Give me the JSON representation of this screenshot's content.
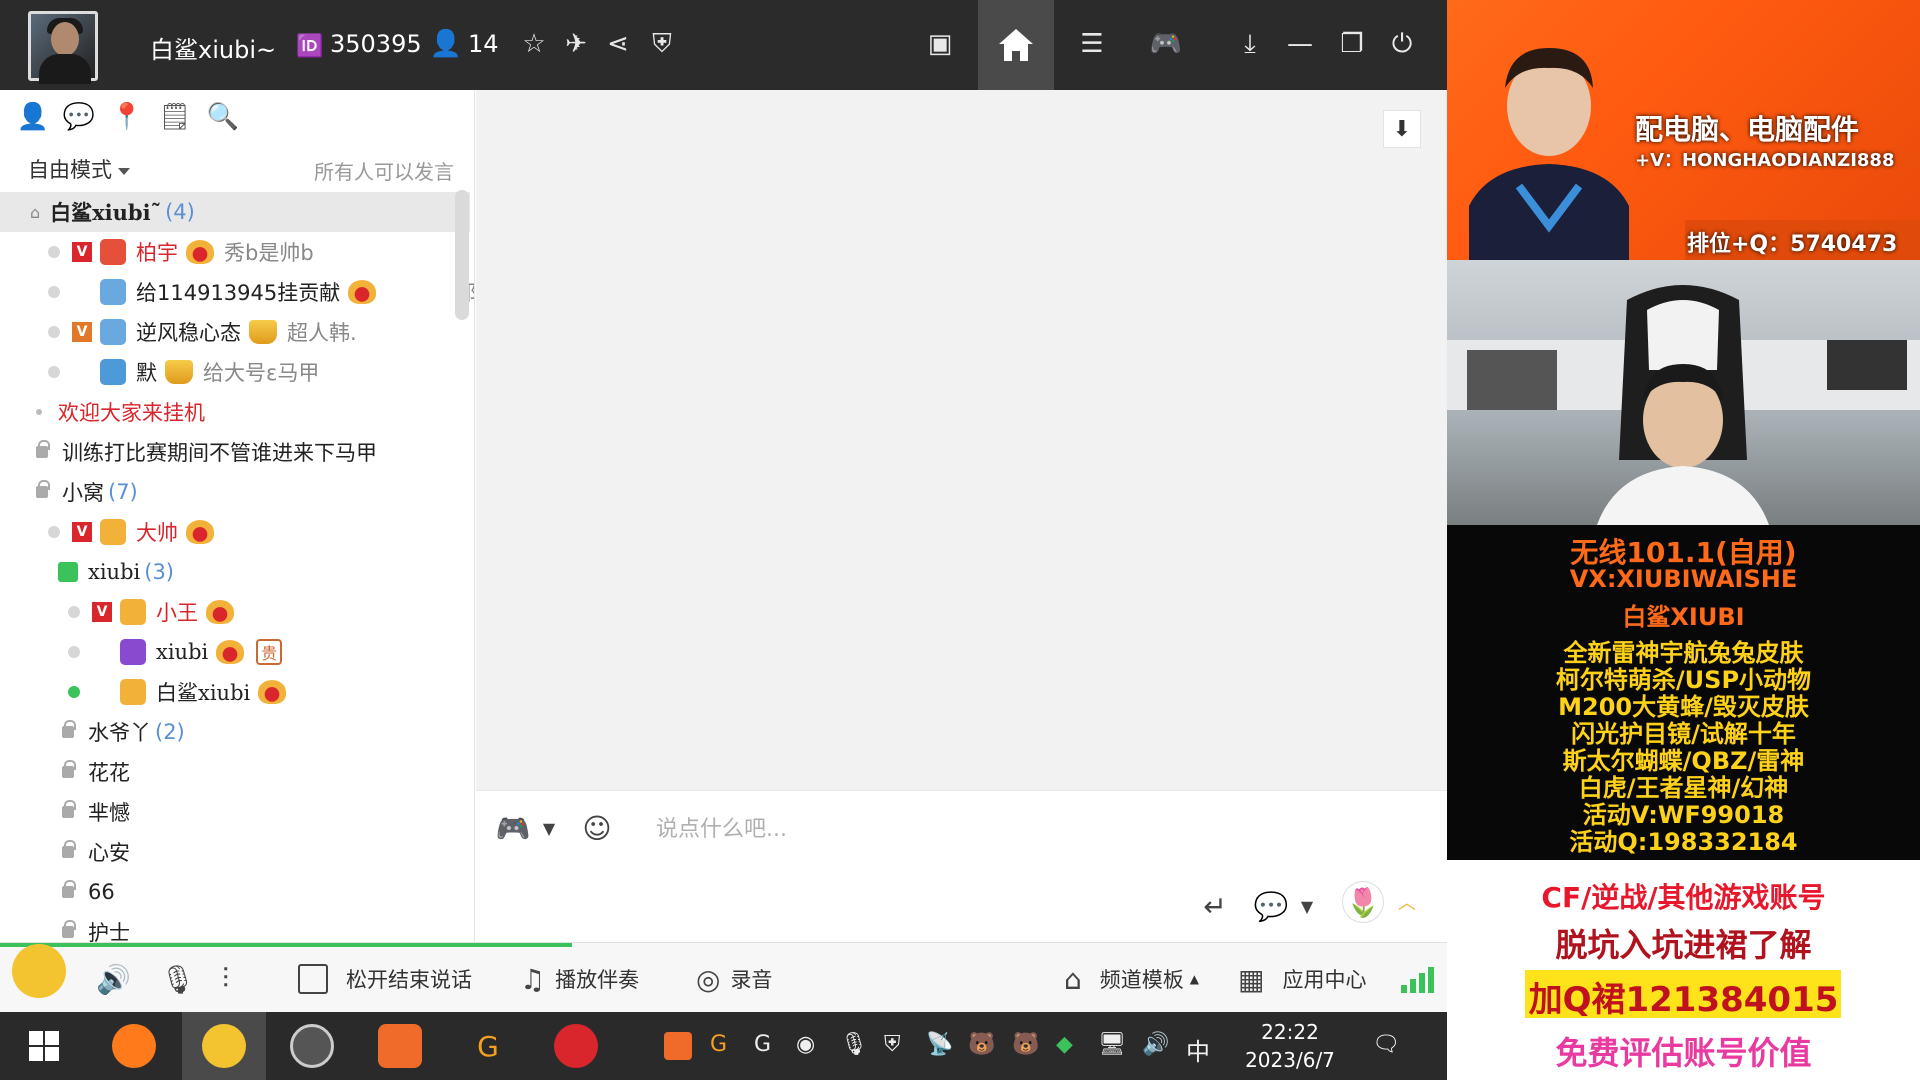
{
  "topbar": {
    "username": "白鲨xiubi~",
    "channel_id": "350395",
    "online_count": "14"
  },
  "left_panel": {
    "mode": "自由模式",
    "speak_status": "所有人可以发言",
    "tree": [
      {
        "name": "白鲨xiubi˜",
        "count": "(4)"
      },
      {
        "name": "柏宇",
        "sig": "秀b是帅b"
      },
      {
        "name": "给114913945挂贡献",
        "sig": "祁"
      },
      {
        "name": "逆风稳心态",
        "sig": "超人韩."
      },
      {
        "name": "默",
        "sig": "给大号ε马甲"
      },
      {
        "name": "欢迎大家来挂机"
      },
      {
        "name": "训练打比赛期间不管谁进来下马甲"
      },
      {
        "name": "小窝",
        "count": "(7)"
      },
      {
        "name": "大帅"
      },
      {
        "name": "xiubi",
        "count": "(3)"
      },
      {
        "name": "小王"
      },
      {
        "name": "xiubi",
        "badge": "贵"
      },
      {
        "name": "白鲨xiubi"
      },
      {
        "name": "水爷丫",
        "count": "(2)"
      },
      {
        "name": "花花"
      },
      {
        "name": "芈憾"
      },
      {
        "name": "心安"
      },
      {
        "name": "66"
      },
      {
        "name": "护士"
      }
    ]
  },
  "chat": {
    "input_placeholder": "说点什么吧..."
  },
  "bottombar": {
    "release_to_end": "松开结束说话",
    "play_accompaniment": "播放伴奏",
    "record": "录音",
    "channel_template": "频道模板",
    "app_center": "应用中心"
  },
  "taskbar": {
    "ime": "中",
    "time": "22:22",
    "date": "2023/6/7"
  },
  "right_panel": {
    "banner": {
      "line1": "配电脑、电脑配件",
      "line2": "+V：HONGHAODIANZI888",
      "line3": "排位+Q：5740473"
    },
    "ad_yellow": [
      "无线101.1(自用)",
      "VX:XIUBIWAISHE",
      "白鲨XIUBI",
      "全新雷神宇航兔兔皮肤",
      "柯尔特萌杀/USP小动物",
      "M200大黄蜂/毁灭皮肤",
      "闪光护目镜/试解十年",
      "斯太尔蝴蝶/QBZ/雷神",
      "白虎/王者星神/幻神",
      "活动V:WF99018",
      "活动Q:198332184"
    ],
    "ad_white": [
      "CF/逆战/其他游戏账号",
      "脱坑入坑进裙了解",
      "加Q裙121384015",
      "免费评估账号价值"
    ]
  },
  "colors": {
    "accent_green": "#3cc25a",
    "vip_red": "#d9262c",
    "banner_orange": "#ff5a10",
    "ad_orange": "#ff6a1a",
    "ad_yellow": "#ffd21a"
  }
}
